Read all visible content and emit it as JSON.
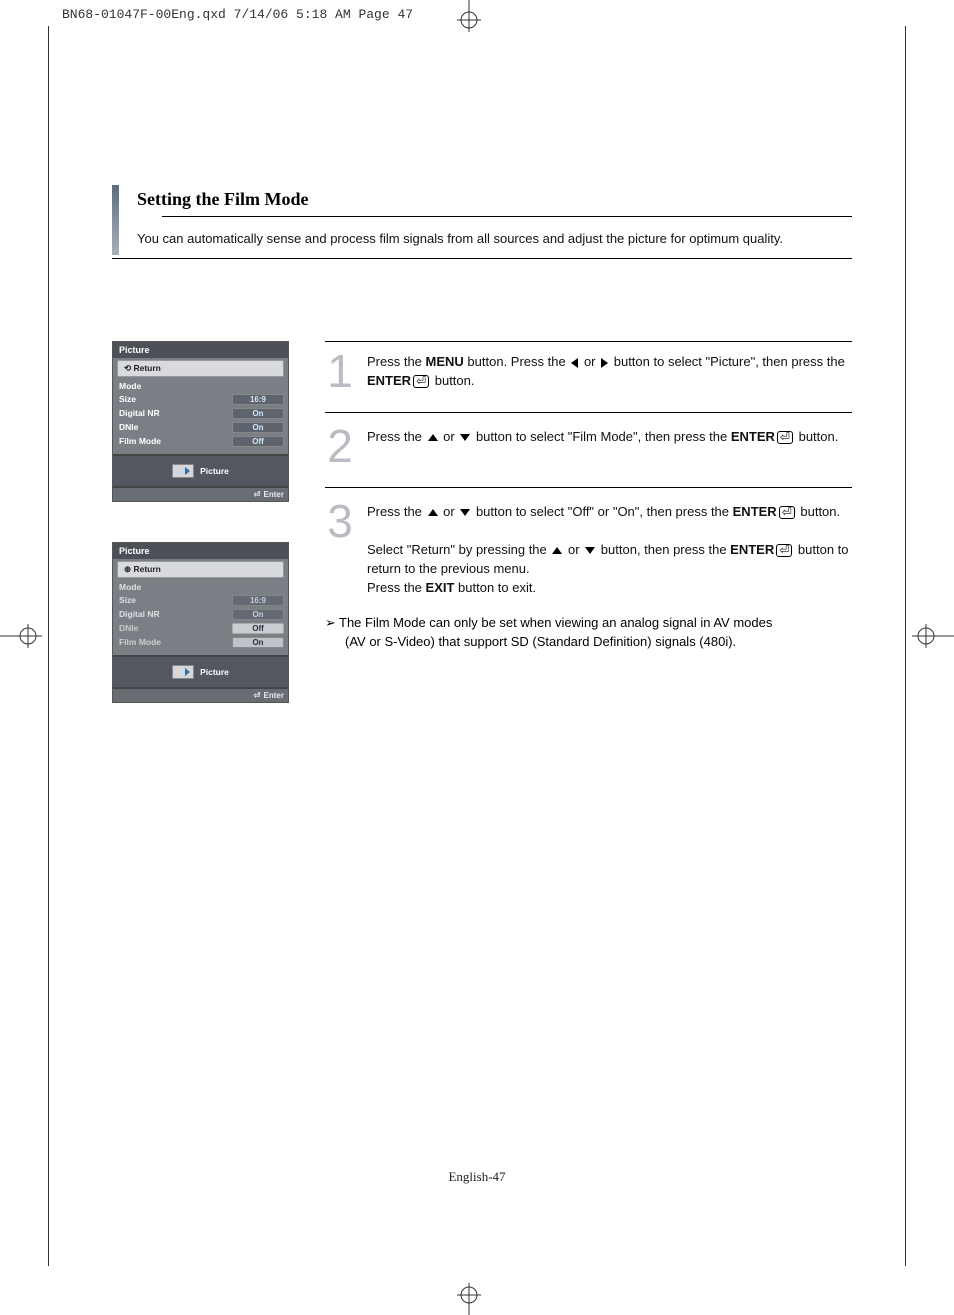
{
  "print_header": "BN68-01047F-00Eng.qxd  7/14/06  5:18 AM  Page 47",
  "section": {
    "title": "Setting the Film Mode",
    "subtitle": "You can automatically sense and process film signals from all sources and adjust the picture for optimum quality."
  },
  "osd1": {
    "title": "Picture",
    "return": "Return",
    "rows": [
      {
        "label": "Mode",
        "value": ""
      },
      {
        "label": "Size",
        "value": "16:9"
      },
      {
        "label": "Digital NR",
        "value": "On"
      },
      {
        "label": "DNIe",
        "value": "On"
      },
      {
        "label": "Film Mode",
        "value": "Off"
      }
    ],
    "mid_label": "Picture",
    "footer": "Enter"
  },
  "osd2": {
    "title": "Picture",
    "return": "Return",
    "rows": [
      {
        "label": "Mode",
        "value": ""
      },
      {
        "label": "Size",
        "value": "16:9"
      },
      {
        "label": "Digital NR",
        "value": "On"
      },
      {
        "label": "DNIe",
        "value": "Off"
      },
      {
        "label": "Film Mode",
        "value": "On"
      }
    ],
    "mid_label": "Picture",
    "footer": "Enter"
  },
  "steps": {
    "s1_a": "Press the ",
    "s1_menu": "MENU",
    "s1_b": " button. Press the ",
    "s1_c": " or ",
    "s1_d": " button to select \"Picture\", then press the ",
    "s1_enter": "ENTER",
    "s1_e": " button.",
    "s2_a": "Press the ",
    "s2_b": " or ",
    "s2_c": " button to select \"Film Mode\", then press the ",
    "s2_enter": "ENTER",
    "s2_d": " button.",
    "s3_a": "Press the ",
    "s3_b": " or ",
    "s3_c": " button to select \"Off\" or \"On\", then press the ",
    "s3_enter": "ENTER",
    "s3_d": " button.",
    "s3_ret_a": "Select \"Return\" by pressing the ",
    "s3_ret_b": " or ",
    "s3_ret_c": " button, then press the ",
    "s3_ret_enter": "ENTER",
    "s3_ret_d": " button to return to the previous menu.",
    "s3_exit_a": "Press the ",
    "s3_exit": "EXIT",
    "s3_exit_b": " button to exit."
  },
  "note": {
    "bullet": "➢",
    "line1": "The Film Mode can only be set when viewing an analog signal in AV modes",
    "line2": "(AV or S-Video) that support SD (Standard Definition) signals (480i)."
  },
  "page_number": "English-47",
  "nums": {
    "n1": "1",
    "n2": "2",
    "n3": "3"
  }
}
